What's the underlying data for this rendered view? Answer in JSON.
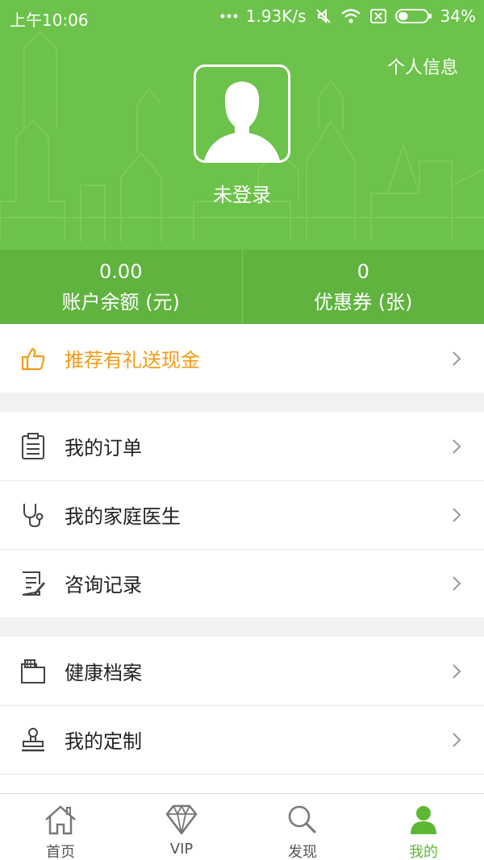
{
  "status_bar": {
    "time": "上午10:06",
    "network_speed": "1.93K/s",
    "battery": "34%",
    "battery_level": 0.34
  },
  "header": {
    "profile_link": "个人信息",
    "login_status": "未登录"
  },
  "stats": [
    {
      "value": "0.00",
      "label": "账户余额 (元)"
    },
    {
      "value": "0",
      "label": "优惠券 (张)"
    }
  ],
  "menu": {
    "referral": {
      "label": "推荐有礼送现金",
      "icon": "thumbs-up-icon",
      "color": "#f29b16"
    },
    "group1": [
      {
        "label": "我的订单",
        "icon": "order-list-icon"
      },
      {
        "label": "我的家庭医生",
        "icon": "stethoscope-icon"
      },
      {
        "label": "咨询记录",
        "icon": "consult-record-icon"
      }
    ],
    "group2": [
      {
        "label": "健康档案",
        "icon": "health-file-icon"
      },
      {
        "label": "我的定制",
        "icon": "stamp-icon"
      }
    ]
  },
  "tabbar": [
    {
      "label": "首页",
      "icon": "home-icon"
    },
    {
      "label": "VIP",
      "icon": "diamond-icon"
    },
    {
      "label": "发现",
      "icon": "search-icon"
    },
    {
      "label": "我的",
      "icon": "person-icon",
      "active": true
    }
  ],
  "colors": {
    "brand_green": "#6cc24a",
    "stats_green": "#60b33f",
    "accent_orange": "#f29b16",
    "active_tab": "#5cb832"
  }
}
